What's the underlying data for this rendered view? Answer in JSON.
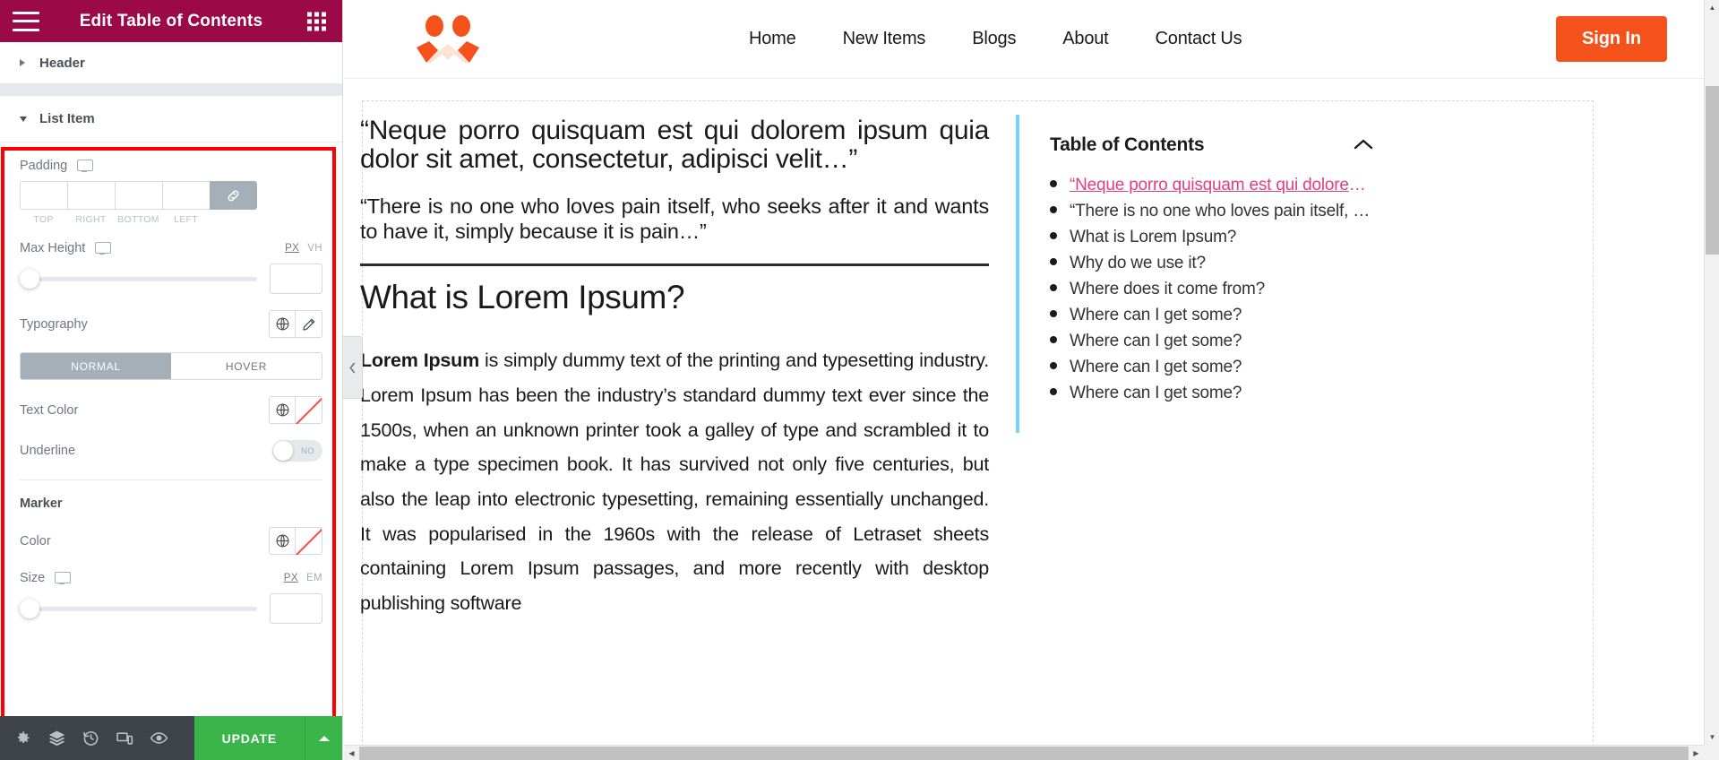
{
  "panel": {
    "title": "Edit Table of Contents",
    "menu_icon": "hamburger-icon",
    "grid_icon": "apps-grid-icon",
    "sections": [
      {
        "label": "Header",
        "expanded": false
      }
    ],
    "list_item": {
      "label": "List Item",
      "expanded": true,
      "padding": {
        "label": "Padding",
        "device_icon": "desktop-icon",
        "values": {
          "top": "",
          "right": "",
          "bottom": "",
          "left": ""
        },
        "sub_labels": [
          "TOP",
          "RIGHT",
          "BOTTOM",
          "LEFT"
        ],
        "link_icon": "link-icon",
        "linked": true
      },
      "max_height": {
        "label": "Max Height",
        "device_icon": "desktop-icon",
        "units": [
          "PX",
          "VH"
        ],
        "active_unit": "PX",
        "value": "",
        "slider_percent": 0
      },
      "typography": {
        "label": "Typography",
        "globe_icon": "globe-icon",
        "edit_icon": "pencil-icon"
      },
      "state_tabs": {
        "tabs": [
          "NORMAL",
          "HOVER"
        ],
        "active": "NORMAL"
      },
      "text_color": {
        "label": "Text Color",
        "globe_icon": "globe-icon",
        "swatch_icon": "empty-color-swatch-icon",
        "value": ""
      },
      "underline": {
        "label": "Underline",
        "state": "NO",
        "on": false
      },
      "marker": {
        "label": "Marker",
        "color": {
          "label": "Color",
          "globe_icon": "globe-icon",
          "swatch_icon": "empty-color-swatch-icon",
          "value": ""
        },
        "size": {
          "label": "Size",
          "device_icon": "desktop-icon",
          "units": [
            "PX",
            "EM"
          ],
          "active_unit": "PX",
          "value": "",
          "slider_percent": 0
        }
      }
    },
    "footer": {
      "icons": [
        {
          "name": "settings-gear-icon"
        },
        {
          "name": "layers-navigator-icon"
        },
        {
          "name": "history-icon"
        },
        {
          "name": "responsive-mode-icon"
        },
        {
          "name": "preview-eye-icon"
        }
      ],
      "update_label": "UPDATE",
      "update_caret_icon": "caret-up-icon",
      "update_color": "#39b54a"
    },
    "collapse_handle_icon": "chevron-left-icon",
    "highlight_color": "#ff0000",
    "header_color": "#9b0a46"
  },
  "preview": {
    "site_header": {
      "logo_name": "brand-logo",
      "logo_color": "#f4521a",
      "nav": [
        "Home",
        "New Items",
        "Blogs",
        "About",
        "Contact Us"
      ],
      "signin_label": "Sign In",
      "signin_color": "#f4521a"
    },
    "article": {
      "quote1": "“Neque porro quisquam est qui dolorem ipsum quia dolor sit amet, consectetur, adipisci velit…”",
      "quote2": "“There is no one who loves pain itself, who seeks after it and wants to have it, simply because it is pain…”",
      "heading": "What is Lorem Ipsum?",
      "para_lead": "Lorem Ipsum",
      "para_rest": " is simply dummy text of the printing and typesetting industry. Lorem Ipsum has been the industry’s standard dummy text ever since the 1500s, when an unknown printer took a galley of type and scrambled it to make a type specimen book. It has survived not only five centuries, but also the leap into electronic typesetting, remaining essentially unchanged. It was popularised in the 1960s with the release of Letraset sheets containing Lorem Ipsum passages, and more recently with desktop publishing software"
    },
    "toc": {
      "title": "Table of Contents",
      "toggle_icon": "chevron-up-icon",
      "accent_color": "#e0407f",
      "selection_border_color": "#7ad1f5",
      "items": [
        {
          "label": "“Neque porro quisquam est qui dolorem ipsu…",
          "active": true
        },
        {
          "label": "“There is no one who loves pain itself, who see…",
          "active": false
        },
        {
          "label": "What is Lorem Ipsum?",
          "active": false
        },
        {
          "label": "Why do we use it?",
          "active": false
        },
        {
          "label": "Where does it come from?",
          "active": false
        },
        {
          "label": "Where can I get some?",
          "active": false
        },
        {
          "label": "Where can I get some?",
          "active": false
        },
        {
          "label": "Where can I get some?",
          "active": false
        },
        {
          "label": "Where can I get some?",
          "active": false
        }
      ]
    }
  },
  "scrollbars": {
    "vertical": {
      "up_icon": "scroll-up-arrow",
      "down_icon": "scroll-down-arrow"
    },
    "horizontal": {
      "left_icon": "scroll-left-arrow",
      "right_icon": "scroll-right-arrow"
    }
  }
}
